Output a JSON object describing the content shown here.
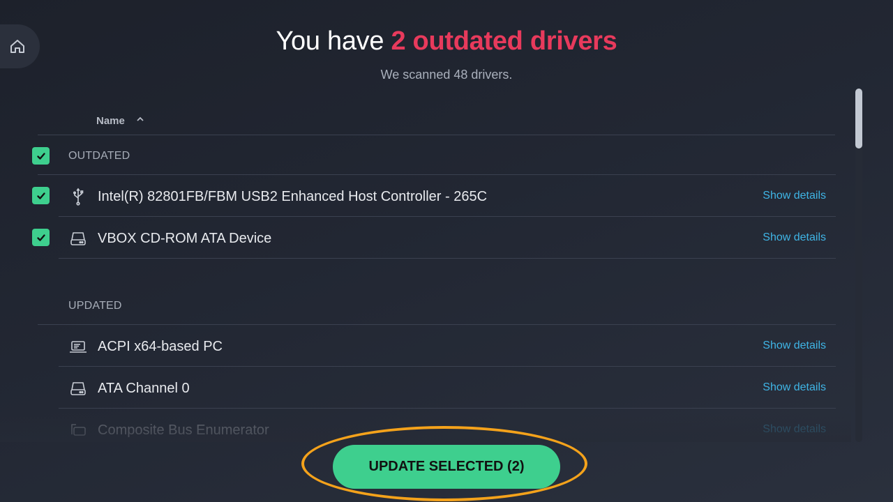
{
  "nav": {
    "home_icon": "home-icon"
  },
  "header": {
    "title_prefix": "You have ",
    "title_highlight": "2 outdated drivers",
    "subtitle": "We scanned 48 drivers."
  },
  "table": {
    "column_name": "Name",
    "sort_icon": "chevron-up-icon",
    "sections": [
      {
        "label": "OUTDATED",
        "checked": true,
        "items": [
          {
            "name": "Intel(R) 82801FB/FBM USB2 Enhanced Host Controller - 265C",
            "icon": "usb-icon",
            "checked": true,
            "link": "Show details"
          },
          {
            "name": "VBOX CD-ROM ATA Device",
            "icon": "drive-icon",
            "checked": true,
            "link": "Show details"
          }
        ]
      },
      {
        "label": "UPDATED",
        "items": [
          {
            "name": "ACPI x64-based PC",
            "icon": "laptop-icon",
            "link": "Show details"
          },
          {
            "name": "ATA Channel 0",
            "icon": "drive-icon",
            "link": "Show details"
          },
          {
            "name": "Composite Bus Enumerator",
            "icon": "devices-icon",
            "link": "Show details"
          }
        ]
      }
    ]
  },
  "actions": {
    "update_button": "UPDATE SELECTED (2)"
  },
  "colors": {
    "accent_green": "#3ecf8e",
    "highlight_red": "#e83a5c",
    "link_blue": "#3fb5e6",
    "annotation_orange": "#f4a21b"
  }
}
